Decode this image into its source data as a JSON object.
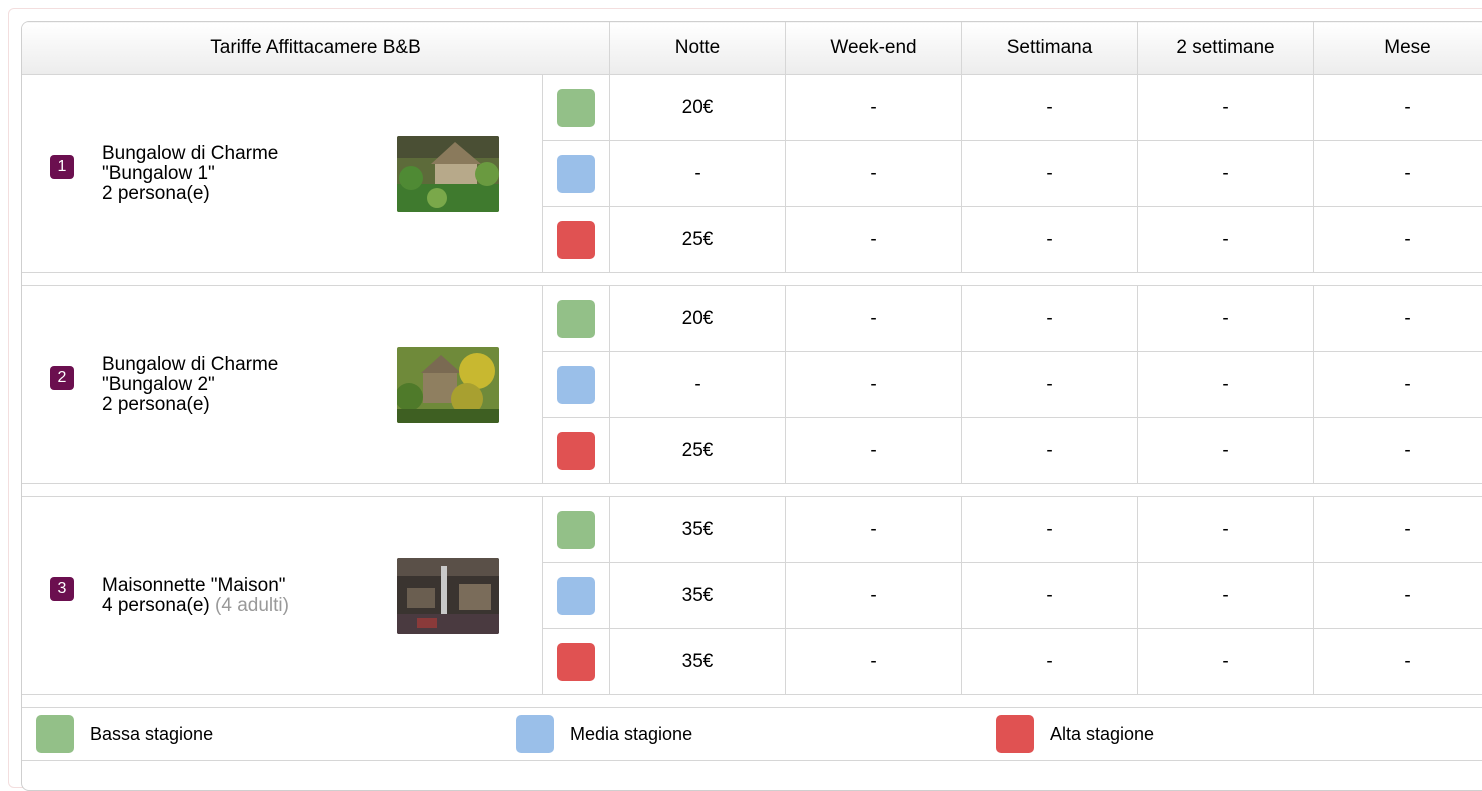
{
  "header": {
    "title": "Tariffe Affittacamere B&B",
    "columns": [
      "Notte",
      "Week-end",
      "Settimana",
      "2 settimane",
      "Mese"
    ]
  },
  "colors": {
    "low": "#93c088",
    "mid": "#9abfe9",
    "high": "#e05252",
    "badge": "#6b0f4f"
  },
  "rooms": [
    {
      "number": "1",
      "name": "Bungalow di Charme",
      "label": "\"Bungalow 1\"",
      "persons": "2 persona(e)",
      "extra": "",
      "rows": [
        [
          "20€",
          "-",
          "-",
          "-",
          "-"
        ],
        [
          "-",
          "-",
          "-",
          "-",
          "-"
        ],
        [
          "25€",
          "-",
          "-",
          "-",
          "-"
        ]
      ]
    },
    {
      "number": "2",
      "name": "Bungalow di Charme",
      "label": "\"Bungalow 2\"",
      "persons": "2 persona(e)",
      "extra": "",
      "rows": [
        [
          "20€",
          "-",
          "-",
          "-",
          "-"
        ],
        [
          "-",
          "-",
          "-",
          "-",
          "-"
        ],
        [
          "25€",
          "-",
          "-",
          "-",
          "-"
        ]
      ]
    },
    {
      "number": "3",
      "name": "Maisonnette \"Maison\"",
      "label": "",
      "persons": "4 persona(e)",
      "extra": "(4 adulti)",
      "rows": [
        [
          "35€",
          "-",
          "-",
          "-",
          "-"
        ],
        [
          "35€",
          "-",
          "-",
          "-",
          "-"
        ],
        [
          "35€",
          "-",
          "-",
          "-",
          "-"
        ]
      ]
    }
  ],
  "legend": {
    "low": "Bassa stagione",
    "mid": "Media stagione",
    "high": "Alta stagione"
  }
}
